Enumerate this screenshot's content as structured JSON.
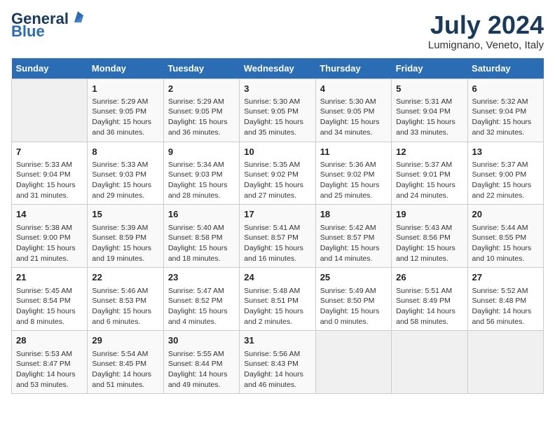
{
  "header": {
    "logo_line1": "General",
    "logo_line2": "Blue",
    "month_year": "July 2024",
    "location": "Lumignano, Veneto, Italy"
  },
  "days_of_week": [
    "Sunday",
    "Monday",
    "Tuesday",
    "Wednesday",
    "Thursday",
    "Friday",
    "Saturday"
  ],
  "weeks": [
    [
      {
        "num": "",
        "info": ""
      },
      {
        "num": "1",
        "info": "Sunrise: 5:29 AM\nSunset: 9:05 PM\nDaylight: 15 hours\nand 36 minutes."
      },
      {
        "num": "2",
        "info": "Sunrise: 5:29 AM\nSunset: 9:05 PM\nDaylight: 15 hours\nand 36 minutes."
      },
      {
        "num": "3",
        "info": "Sunrise: 5:30 AM\nSunset: 9:05 PM\nDaylight: 15 hours\nand 35 minutes."
      },
      {
        "num": "4",
        "info": "Sunrise: 5:30 AM\nSunset: 9:05 PM\nDaylight: 15 hours\nand 34 minutes."
      },
      {
        "num": "5",
        "info": "Sunrise: 5:31 AM\nSunset: 9:04 PM\nDaylight: 15 hours\nand 33 minutes."
      },
      {
        "num": "6",
        "info": "Sunrise: 5:32 AM\nSunset: 9:04 PM\nDaylight: 15 hours\nand 32 minutes."
      }
    ],
    [
      {
        "num": "7",
        "info": "Sunrise: 5:33 AM\nSunset: 9:04 PM\nDaylight: 15 hours\nand 31 minutes."
      },
      {
        "num": "8",
        "info": "Sunrise: 5:33 AM\nSunset: 9:03 PM\nDaylight: 15 hours\nand 29 minutes."
      },
      {
        "num": "9",
        "info": "Sunrise: 5:34 AM\nSunset: 9:03 PM\nDaylight: 15 hours\nand 28 minutes."
      },
      {
        "num": "10",
        "info": "Sunrise: 5:35 AM\nSunset: 9:02 PM\nDaylight: 15 hours\nand 27 minutes."
      },
      {
        "num": "11",
        "info": "Sunrise: 5:36 AM\nSunset: 9:02 PM\nDaylight: 15 hours\nand 25 minutes."
      },
      {
        "num": "12",
        "info": "Sunrise: 5:37 AM\nSunset: 9:01 PM\nDaylight: 15 hours\nand 24 minutes."
      },
      {
        "num": "13",
        "info": "Sunrise: 5:37 AM\nSunset: 9:00 PM\nDaylight: 15 hours\nand 22 minutes."
      }
    ],
    [
      {
        "num": "14",
        "info": "Sunrise: 5:38 AM\nSunset: 9:00 PM\nDaylight: 15 hours\nand 21 minutes."
      },
      {
        "num": "15",
        "info": "Sunrise: 5:39 AM\nSunset: 8:59 PM\nDaylight: 15 hours\nand 19 minutes."
      },
      {
        "num": "16",
        "info": "Sunrise: 5:40 AM\nSunset: 8:58 PM\nDaylight: 15 hours\nand 18 minutes."
      },
      {
        "num": "17",
        "info": "Sunrise: 5:41 AM\nSunset: 8:57 PM\nDaylight: 15 hours\nand 16 minutes."
      },
      {
        "num": "18",
        "info": "Sunrise: 5:42 AM\nSunset: 8:57 PM\nDaylight: 15 hours\nand 14 minutes."
      },
      {
        "num": "19",
        "info": "Sunrise: 5:43 AM\nSunset: 8:56 PM\nDaylight: 15 hours\nand 12 minutes."
      },
      {
        "num": "20",
        "info": "Sunrise: 5:44 AM\nSunset: 8:55 PM\nDaylight: 15 hours\nand 10 minutes."
      }
    ],
    [
      {
        "num": "21",
        "info": "Sunrise: 5:45 AM\nSunset: 8:54 PM\nDaylight: 15 hours\nand 8 minutes."
      },
      {
        "num": "22",
        "info": "Sunrise: 5:46 AM\nSunset: 8:53 PM\nDaylight: 15 hours\nand 6 minutes."
      },
      {
        "num": "23",
        "info": "Sunrise: 5:47 AM\nSunset: 8:52 PM\nDaylight: 15 hours\nand 4 minutes."
      },
      {
        "num": "24",
        "info": "Sunrise: 5:48 AM\nSunset: 8:51 PM\nDaylight: 15 hours\nand 2 minutes."
      },
      {
        "num": "25",
        "info": "Sunrise: 5:49 AM\nSunset: 8:50 PM\nDaylight: 15 hours\nand 0 minutes."
      },
      {
        "num": "26",
        "info": "Sunrise: 5:51 AM\nSunset: 8:49 PM\nDaylight: 14 hours\nand 58 minutes."
      },
      {
        "num": "27",
        "info": "Sunrise: 5:52 AM\nSunset: 8:48 PM\nDaylight: 14 hours\nand 56 minutes."
      }
    ],
    [
      {
        "num": "28",
        "info": "Sunrise: 5:53 AM\nSunset: 8:47 PM\nDaylight: 14 hours\nand 53 minutes."
      },
      {
        "num": "29",
        "info": "Sunrise: 5:54 AM\nSunset: 8:45 PM\nDaylight: 14 hours\nand 51 minutes."
      },
      {
        "num": "30",
        "info": "Sunrise: 5:55 AM\nSunset: 8:44 PM\nDaylight: 14 hours\nand 49 minutes."
      },
      {
        "num": "31",
        "info": "Sunrise: 5:56 AM\nSunset: 8:43 PM\nDaylight: 14 hours\nand 46 minutes."
      },
      {
        "num": "",
        "info": ""
      },
      {
        "num": "",
        "info": ""
      },
      {
        "num": "",
        "info": ""
      }
    ]
  ]
}
